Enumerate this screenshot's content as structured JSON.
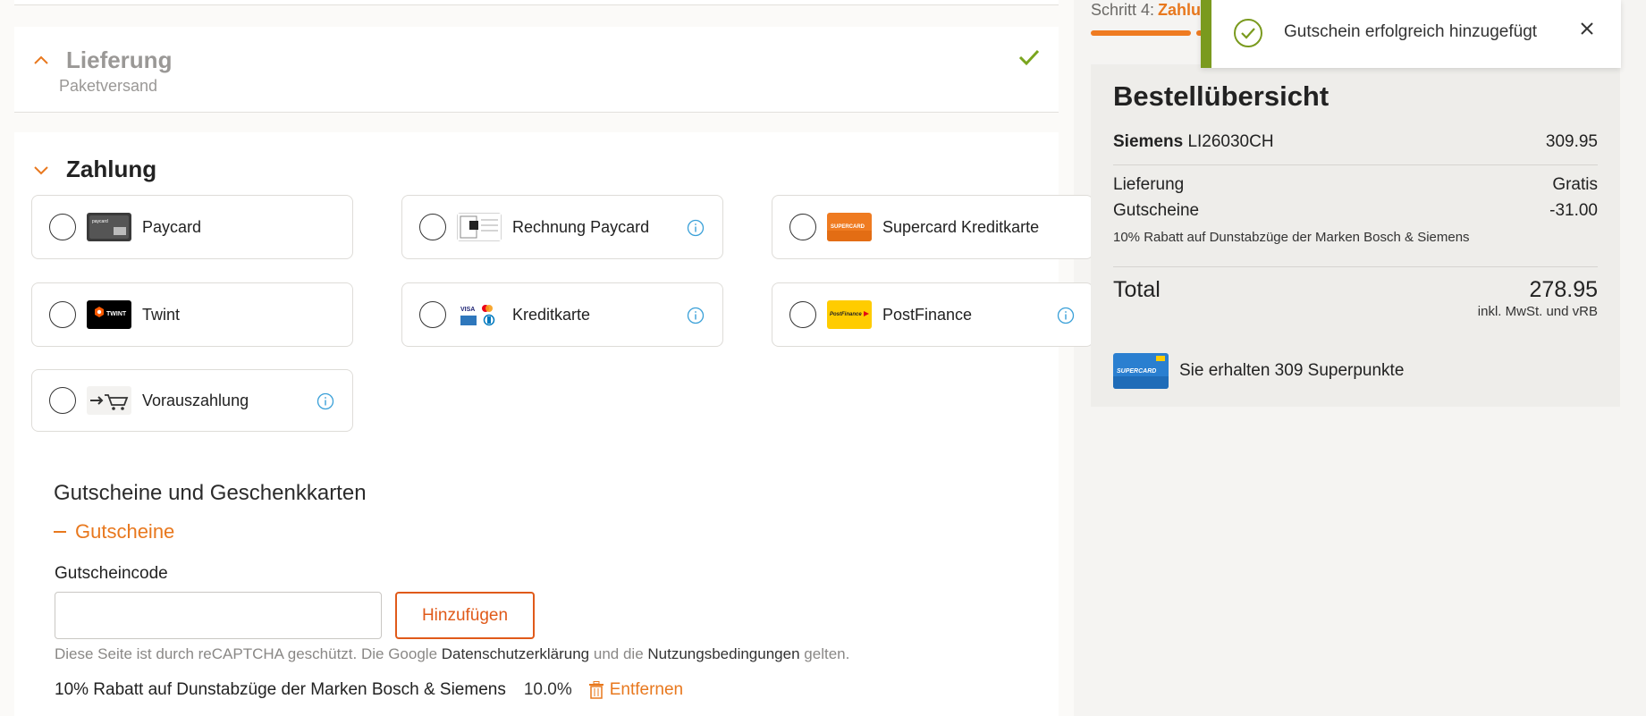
{
  "step": {
    "prefix": "Schritt 4:",
    "current": "Zahlu",
    "progress_fraction": 0.75
  },
  "delivery": {
    "title": "Lieferung",
    "subtitle": "Paketversand",
    "completed": true
  },
  "payment": {
    "title": "Zahlung",
    "options": [
      {
        "label": "Paycard",
        "logo": "paycard-logo",
        "info": false
      },
      {
        "label": "Rechnung Paycard",
        "logo": "invoice-logo",
        "info": true
      },
      {
        "label": "Supercard Kreditkarte",
        "logo": "supercard-credit-logo",
        "info": false
      },
      {
        "label": "Twint",
        "logo": "twint-logo",
        "info": false
      },
      {
        "label": "Kreditkarte",
        "logo": "creditcards-logo",
        "info": true
      },
      {
        "label": "PostFinance",
        "logo": "postfinance-logo",
        "info": true
      },
      {
        "label": "Vorauszahlung",
        "logo": "prepayment-logo",
        "info": true
      }
    ]
  },
  "gift": {
    "title": "Gutscheine und Geschenkkarten",
    "toggle_label": "Gutscheine",
    "code_label": "Gutscheincode",
    "code_value": "",
    "add_button": "Hinzufügen",
    "recaptcha": {
      "prefix": "Diese Seite ist durch reCAPTCHA geschützt. Die Google",
      "privacy": "Datenschutzerklärung",
      "middle": "und die",
      "terms": "Nutzungsbedingungen",
      "suffix": "gelten."
    },
    "applied": {
      "name": "10% Rabatt auf Dunstabzüge der Marken Bosch & Siemens",
      "percent": "10.0%",
      "remove": "Entfernen"
    }
  },
  "summary": {
    "title": "Bestellübersicht",
    "item_brand": "Siemens",
    "item_model": "LI26030CH",
    "item_price": "309.95",
    "delivery_label": "Lieferung",
    "delivery_value": "Gratis",
    "voucher_label": "Gutscheine",
    "voucher_value": "-31.00",
    "voucher_note": "10% Rabatt auf Dunstabzüge der Marken Bosch & Siemens",
    "total_label": "Total",
    "total_value": "278.95",
    "total_note": "inkl. MwSt. und vRB",
    "points_text": "Sie erhalten 309 Superpunkte"
  },
  "toast": {
    "message": "Gutschein erfolgreich hinzugefügt"
  },
  "colors": {
    "accent": "#e8781e",
    "success": "#7a9a1e",
    "info": "#3aa0d8"
  }
}
